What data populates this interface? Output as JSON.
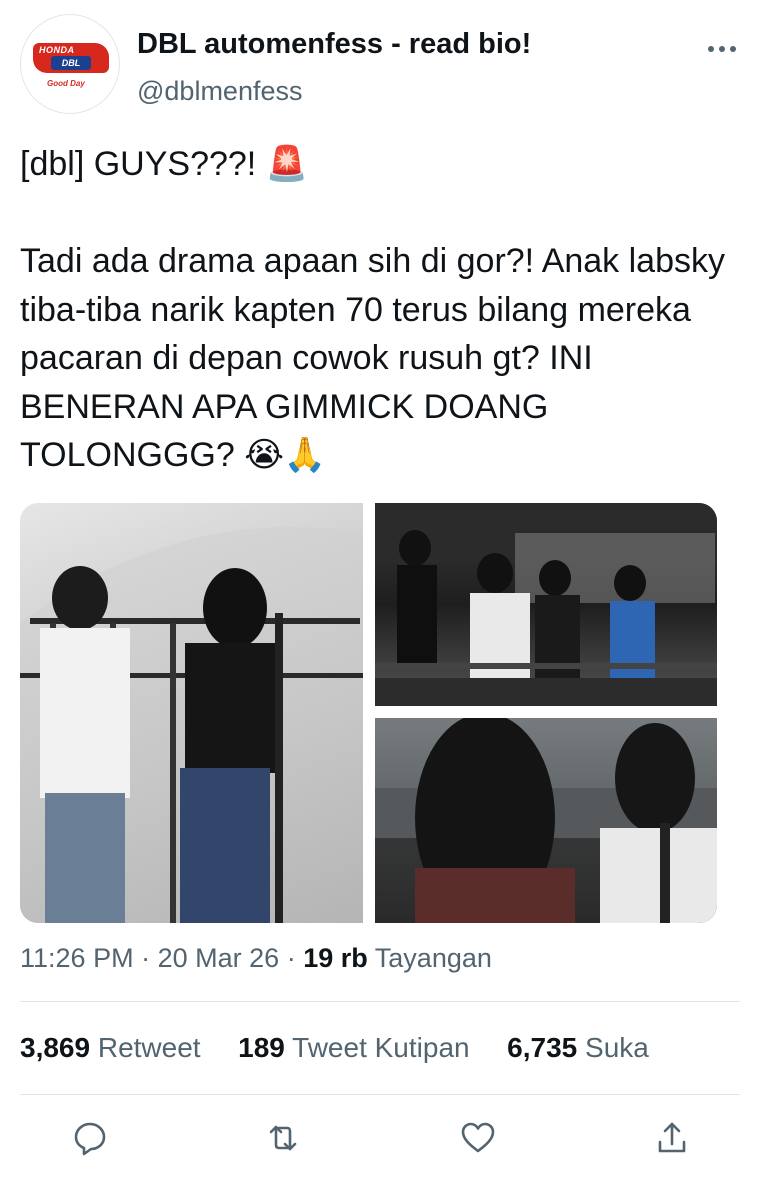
{
  "tweet": {
    "display_name": "DBL automenfess - read bio!",
    "handle": "@dblmenfess",
    "avatar": {
      "brand": "HONDA",
      "badge": "DBL",
      "sub": "Good Day"
    },
    "text": "[dbl] GUYS???! 🚨\n\nTadi ada drama apaan sih di gor?! Anak labsky tiba-tiba narik kapten 70 terus bilang mereka pacaran di depan cowok rusuh gt? INI BENERAN APA GIMMICK DOANG TOLONGGG? 😭🙏",
    "time": "11:26 PM",
    "separator": "·",
    "date": "20 Mar 26",
    "views_count": "19 rb",
    "views_label": "Tayangan",
    "stats": {
      "retweets_count": "3,869",
      "retweets_label": "Retweet",
      "quotes_count": "189",
      "quotes_label": "Tweet Kutipan",
      "likes_count": "6,735",
      "likes_label": "Suka"
    },
    "media": [
      "photo",
      "photo",
      "photo"
    ]
  },
  "icons": {
    "more": "more-dots-icon",
    "reply": "reply-icon",
    "retweet": "retweet-icon",
    "like": "heart-icon",
    "share": "share-icon"
  },
  "colors": {
    "text": "#0f1419",
    "secondary": "#536471",
    "divider": "#e1e5e8"
  }
}
